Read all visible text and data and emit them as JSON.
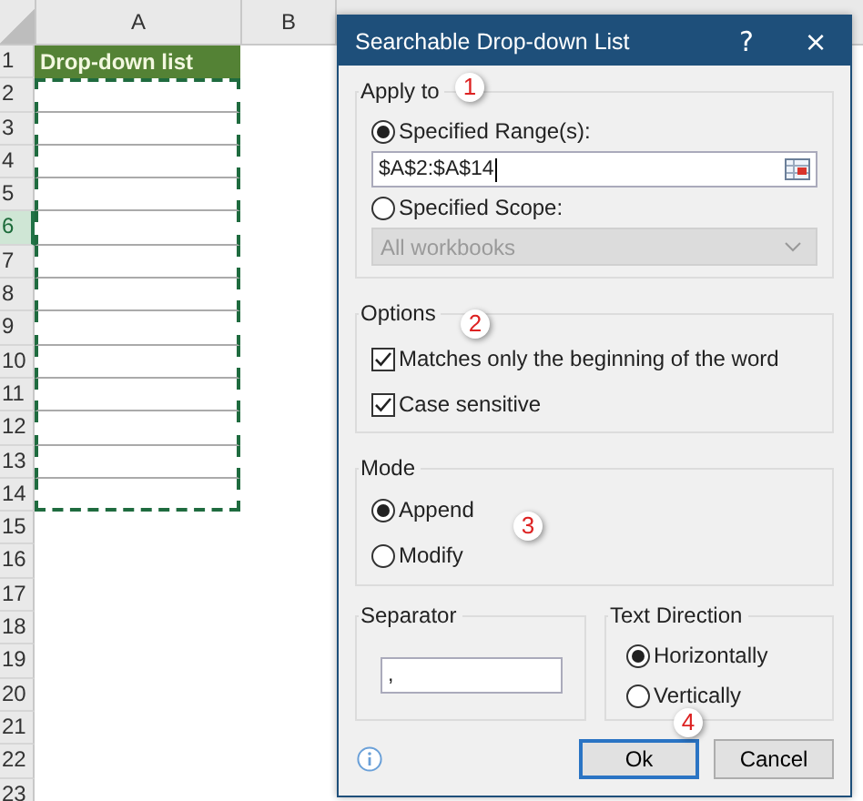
{
  "sheet": {
    "columns": [
      "A",
      "B"
    ],
    "rows": [
      {
        "number": "1",
        "selected": false,
        "cell": "Drop-down list",
        "kind": "header",
        "in_range": false
      },
      {
        "number": "2",
        "selected": false,
        "in_range": true
      },
      {
        "number": "3",
        "selected": false,
        "in_range": true
      },
      {
        "number": "4",
        "selected": false,
        "in_range": true
      },
      {
        "number": "5",
        "selected": false,
        "in_range": true
      },
      {
        "number": "6",
        "selected": true,
        "in_range": true
      },
      {
        "number": "7",
        "selected": false,
        "in_range": true
      },
      {
        "number": "8",
        "selected": false,
        "in_range": true
      },
      {
        "number": "9",
        "selected": false,
        "in_range": true
      },
      {
        "number": "10",
        "selected": false,
        "in_range": true
      },
      {
        "number": "11",
        "selected": false,
        "in_range": true
      },
      {
        "number": "12",
        "selected": false,
        "in_range": true
      },
      {
        "number": "13",
        "selected": false,
        "in_range": true
      },
      {
        "number": "14",
        "selected": false,
        "in_range": true
      },
      {
        "number": "15",
        "selected": false,
        "in_range": false
      },
      {
        "number": "16",
        "selected": false,
        "in_range": false
      },
      {
        "number": "17",
        "selected": false,
        "in_range": false
      },
      {
        "number": "18",
        "selected": false,
        "in_range": false
      },
      {
        "number": "19",
        "selected": false,
        "in_range": false
      },
      {
        "number": "20",
        "selected": false,
        "in_range": false
      },
      {
        "number": "21",
        "selected": false,
        "in_range": false
      },
      {
        "number": "22",
        "selected": false,
        "in_range": false
      },
      {
        "number": "23",
        "selected": false,
        "in_range": false
      }
    ]
  },
  "dialog": {
    "title": "Searchable Drop-down List",
    "help": "?",
    "close": "×",
    "apply_to": {
      "title": "Apply to",
      "step": "1",
      "range": {
        "label": "Specified Range(s):",
        "selected": true,
        "value": "$A$2:$A$14"
      },
      "scope": {
        "label": "Specified Scope:",
        "selected": false,
        "value": "All workbooks",
        "disabled": true
      }
    },
    "options": {
      "title": "Options",
      "step": "2",
      "checkboxes": [
        {
          "label": "Matches only the beginning of the word",
          "checked": true
        },
        {
          "label": "Case sensitive",
          "checked": true
        }
      ]
    },
    "mode": {
      "title": "Mode",
      "step": "3",
      "choices": [
        {
          "label": "Append",
          "selected": true
        },
        {
          "label": "Modify",
          "selected": false
        }
      ]
    },
    "separator": {
      "title": "Separator",
      "value": ","
    },
    "text_direction": {
      "title": "Text Direction",
      "choices": [
        {
          "label": "Horizontally",
          "selected": true
        },
        {
          "label": "Vertically",
          "selected": false
        }
      ]
    },
    "buttons": [
      {
        "label": "Ok",
        "default": true
      },
      {
        "label": "Cancel",
        "default": false
      }
    ],
    "step": "4"
  }
}
